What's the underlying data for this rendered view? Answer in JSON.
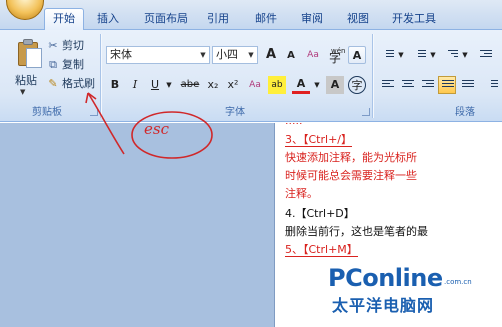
{
  "tabs": [
    {
      "label": "开始",
      "active": true
    },
    {
      "label": "插入",
      "active": false
    },
    {
      "label": "页面布局",
      "active": false
    },
    {
      "label": "引用",
      "active": false
    },
    {
      "label": "邮件",
      "active": false
    },
    {
      "label": "审阅",
      "active": false
    },
    {
      "label": "视图",
      "active": false
    },
    {
      "label": "开发工具",
      "active": false
    }
  ],
  "clipboard": {
    "paste_label": "粘贴",
    "cut_label": "剪切",
    "copy_label": "复制",
    "format_painter_label": "格式刷",
    "group_title": "剪贴板"
  },
  "font": {
    "name_value": "宋体",
    "size_value": "小四",
    "group_title": "字体",
    "bold": "B",
    "italic": "I",
    "underline": "U",
    "strike": "abe",
    "subscript": "x₂",
    "superscript": "x²",
    "clear": "Aa",
    "grow": "A",
    "shrink": "A",
    "highlight": "ab",
    "font_color": "A",
    "char_shading": "A",
    "enclose": "字",
    "phonetic": "A"
  },
  "paragraph": {
    "group_title": "段落"
  },
  "annotation": {
    "text": "esc",
    "color": "#d0282a"
  },
  "document": {
    "lines": [
      {
        "text": "3、【Ctrl+/】",
        "color": "red"
      },
      {
        "text": "快速添加注释，能为光标所",
        "color": "red"
      },
      {
        "text": "时候可能总会需要注释一些",
        "color": "red"
      },
      {
        "text": "注释。",
        "color": "red"
      },
      {
        "text": "4.【Ctrl+D】",
        "color": "black"
      },
      {
        "text": "删除当前行，这也是笔者的最",
        "color": "black"
      },
      {
        "text": "5、【Ctrl+M】",
        "color": "red"
      }
    ]
  },
  "watermark": {
    "logo": "PConline",
    "domain": ".com.cn",
    "chinese": "太平洋电脑网"
  }
}
